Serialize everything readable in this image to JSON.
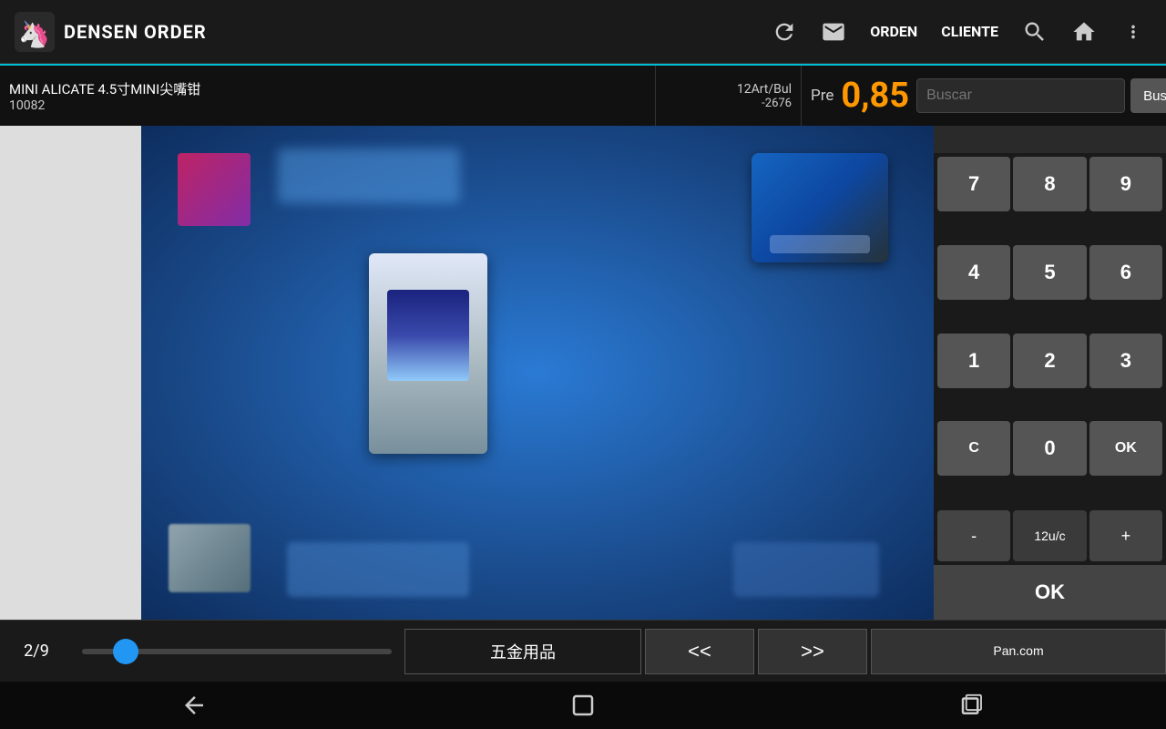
{
  "app": {
    "title": "DENSEN ORDER"
  },
  "nav": {
    "orden_label": "ORDEN",
    "cliente_label": "CLIENTE",
    "refresh_icon": "refresh-icon",
    "mail_icon": "mail-icon",
    "search_icon": "search-icon",
    "home_icon": "home-icon",
    "more_icon": "more-icon"
  },
  "product": {
    "name": "MINI ALICATE 4.5寸MINI尖嘴钳",
    "code": "10082",
    "art_bul": "12Art/Bul",
    "bul_code": "-2676",
    "pre_label": "Pre",
    "price": "0,85",
    "search_placeholder": "Buscar",
    "buscar_label": "Buscar"
  },
  "numpad": {
    "buttons": [
      "7",
      "8",
      "9",
      "4",
      "5",
      "6",
      "1",
      "2",
      "3",
      "C",
      "0",
      "OK"
    ],
    "minus_label": "-",
    "unit_label": "12u/c",
    "plus_label": "+"
  },
  "ok_large": {
    "label": "OK"
  },
  "bottom_bar": {
    "page_current": "2",
    "page_total": "9",
    "category": "五金用品",
    "prev_label": "<<",
    "next_label": ">>",
    "pan_label": "Pan.com"
  },
  "android_nav": {
    "back_icon": "back-icon",
    "home_icon": "home-nav-icon",
    "recents_icon": "recents-icon"
  }
}
